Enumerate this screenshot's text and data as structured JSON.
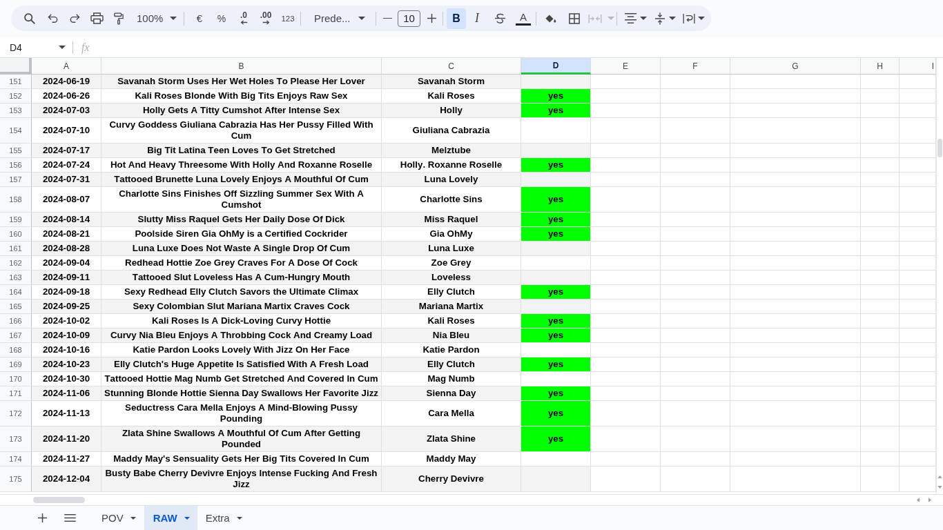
{
  "toolbar": {
    "zoom": "100%",
    "number_formats": [
      {
        "kind": "currency",
        "label": "€"
      },
      {
        "kind": "percent",
        "label": "%"
      },
      {
        "kind": "decrease_decimal",
        "label": ".0"
      },
      {
        "kind": "increase_decimal",
        "label": ".00"
      },
      {
        "kind": "more_formats",
        "label": "123"
      }
    ],
    "font": "Prede...",
    "font_size": "10",
    "text_styles": [
      {
        "kind": "bold",
        "label": "B",
        "on": true
      },
      {
        "kind": "italic",
        "label": "I",
        "on": false
      },
      {
        "kind": "strikethrough",
        "on": false
      },
      {
        "kind": "text_color",
        "label": "A"
      }
    ],
    "merge_cells": {
      "disabled": true
    }
  },
  "formula_bar": {
    "name_box": "D4",
    "label": "fx"
  },
  "columns": [
    {
      "label": "A",
      "selected": false
    },
    {
      "label": "B",
      "selected": false
    },
    {
      "label": "C",
      "selected": false
    },
    {
      "label": "D",
      "selected": true
    },
    {
      "label": "E",
      "selected": false
    },
    {
      "label": "F",
      "selected": false
    },
    {
      "label": "G",
      "selected": false
    },
    {
      "label": "H",
      "selected": false
    },
    {
      "label": "I",
      "selected": false
    }
  ],
  "rows": [
    {
      "number": "151",
      "column_a": "2024-06-19",
      "column_b": "Savanah Storm Uses Her Wet Holes To Please Her Lover",
      "column_c": "Savanah Storm"
    },
    {
      "number": "152",
      "column_a": "2024-06-26",
      "column_b": "Kali Roses Blonde With Big Tits Enjoys Raw Sex",
      "column_c": "Kali Roses",
      "column_d": {
        "value": "yes",
        "color": "#00ff00"
      }
    },
    {
      "number": "153",
      "column_a": "2024-07-03",
      "column_b": "Holly Gets A Titty Cumshot After Intense Sex",
      "column_c": "Holly",
      "column_d": {
        "value": "yes",
        "color": "#00ff00"
      }
    },
    {
      "number": "154",
      "column_a": "2024-07-10",
      "column_b": "Curvy Goddess Giuliana Cabrazia Has Her Pussy Filled With Cum",
      "column_c": "Giuliana Cabrazia"
    },
    {
      "number": "155",
      "column_a": "2024-07-17",
      "column_b": "Big Tit Latina Teen Loves To Get Stretched",
      "column_c": "Melztube"
    },
    {
      "number": "156",
      "column_a": "2024-07-24",
      "column_b": "Hot And Heavy Threesome With Holly And Roxanne Roselle",
      "column_c": "Holly. Roxanne Roselle",
      "column_d": {
        "value": "yes",
        "color": "#00ff00"
      }
    },
    {
      "number": "157",
      "column_a": "2024-07-31",
      "column_b": "Tattooed Brunette Luna Lovely Enjoys A Mouthful Of Cum",
      "column_c": "Luna Lovely"
    },
    {
      "number": "158",
      "column_a": "2024-08-07",
      "column_b": "Charlotte Sins Finishes Off Sizzling Summer Sex With A Cumshot",
      "column_c": "Charlotte Sins",
      "column_d": {
        "value": "yes",
        "color": "#00ff00"
      }
    },
    {
      "number": "159",
      "column_a": "2024-08-14",
      "column_b": "Slutty Miss Raquel Gets Her Daily Dose Of Dick",
      "column_c": "Miss Raquel",
      "column_d": {
        "value": "yes",
        "color": "#00ff00"
      }
    },
    {
      "number": "160",
      "column_a": "2024-08-21",
      "column_b": "Poolside Siren Gia OhMy is a Certified Cockrider",
      "column_c": "Gia OhMy",
      "column_d": {
        "value": "yes",
        "color": "#00ff00"
      }
    },
    {
      "number": "161",
      "column_a": "2024-08-28",
      "column_b": "Luna Luxe Does Not Waste A Single Drop Of Cum",
      "column_c": "Luna Luxe"
    },
    {
      "number": "162",
      "column_a": "2024-09-04",
      "column_b": "Redhead Hottie Zoe Grey Craves For A Dose Of Cock",
      "column_c": "Zoe Grey"
    },
    {
      "number": "163",
      "column_a": "2024-09-11",
      "column_b": "Tattooed Slut Loveless Has A Cum-Hungry Mouth",
      "column_c": "Loveless"
    },
    {
      "number": "164",
      "column_a": "2024-09-18",
      "column_b": "Sexy Redhead Elly Clutch Savors the Ultimate Climax",
      "column_c": "Elly Clutch",
      "column_d": {
        "value": "yes",
        "color": "#00ff00"
      }
    },
    {
      "number": "165",
      "column_a": "2024-09-25",
      "column_b": "Sexy Colombian Slut Mariana Martix Craves Cock",
      "column_c": "Mariana Martix"
    },
    {
      "number": "166",
      "column_a": "2024-10-02",
      "column_b": "Kali Roses Is A Dick-Loving Curvy Hottie",
      "column_c": "Kali Roses",
      "column_d": {
        "value": "yes",
        "color": "#00ff00"
      }
    },
    {
      "number": "167",
      "column_a": "2024-10-09",
      "column_b": "Curvy Nia Bleu Enjoys A Throbbing Cock And Creamy Load",
      "column_c": "Nia Bleu",
      "column_d": {
        "value": "yes",
        "color": "#00ff00"
      }
    },
    {
      "number": "168",
      "column_a": "2024-10-16",
      "column_b": "Katie Pardon Looks Lovely With Jizz On Her Face",
      "column_c": "Katie Pardon"
    },
    {
      "number": "169",
      "column_a": "2024-10-23",
      "column_b": "Elly Clutch's Huge Appetite Is Satisfied With A Fresh Load",
      "column_c": "Elly Clutch",
      "column_d": {
        "value": "yes",
        "color": "#00ff00"
      }
    },
    {
      "number": "170",
      "column_a": "2024-10-30",
      "column_b": "Tattooed Hottie Mag Numb Get Stretched And Covered In Cum",
      "column_c": "Mag Numb"
    },
    {
      "number": "171",
      "column_a": "2024-11-06",
      "column_b": "Stunning Blonde Hottie Sienna Day Swallows Her Favorite Jizz",
      "column_c": "Sienna Day",
      "column_d": {
        "value": "yes",
        "color": "#00ff00"
      }
    },
    {
      "number": "172",
      "column_a": "2024-11-13",
      "column_b": "Seductress Cara Mella Enjoys A Mind-Blowing Pussy Pounding",
      "column_c": "Cara Mella",
      "column_d": {
        "value": "yes",
        "color": "#00ff00"
      }
    },
    {
      "number": "173",
      "column_a": "2024-11-20",
      "column_b": "Zlata Shine Swallows A Mouthful Of Cum After Getting Pounded",
      "column_c": "Zlata Shine",
      "column_d": {
        "value": "yes",
        "color": "#00ff00"
      }
    },
    {
      "number": "174",
      "column_a": "2024-11-27",
      "column_b": "Maddy May's Sensuality Gets Her Big Tits Covered In Cum",
      "column_c": "Maddy May"
    },
    {
      "number": "175",
      "column_a": "2024-12-04",
      "column_b": "Busty Babe Cherry Devivre Enjoys Intense Fucking And Fresh Jizz",
      "column_c": "Cherry Devivre"
    }
  ],
  "sheets": [
    {
      "label": "POV",
      "selected": false
    },
    {
      "label": "RAW",
      "selected": true
    },
    {
      "label": "Extra",
      "selected": false
    }
  ]
}
